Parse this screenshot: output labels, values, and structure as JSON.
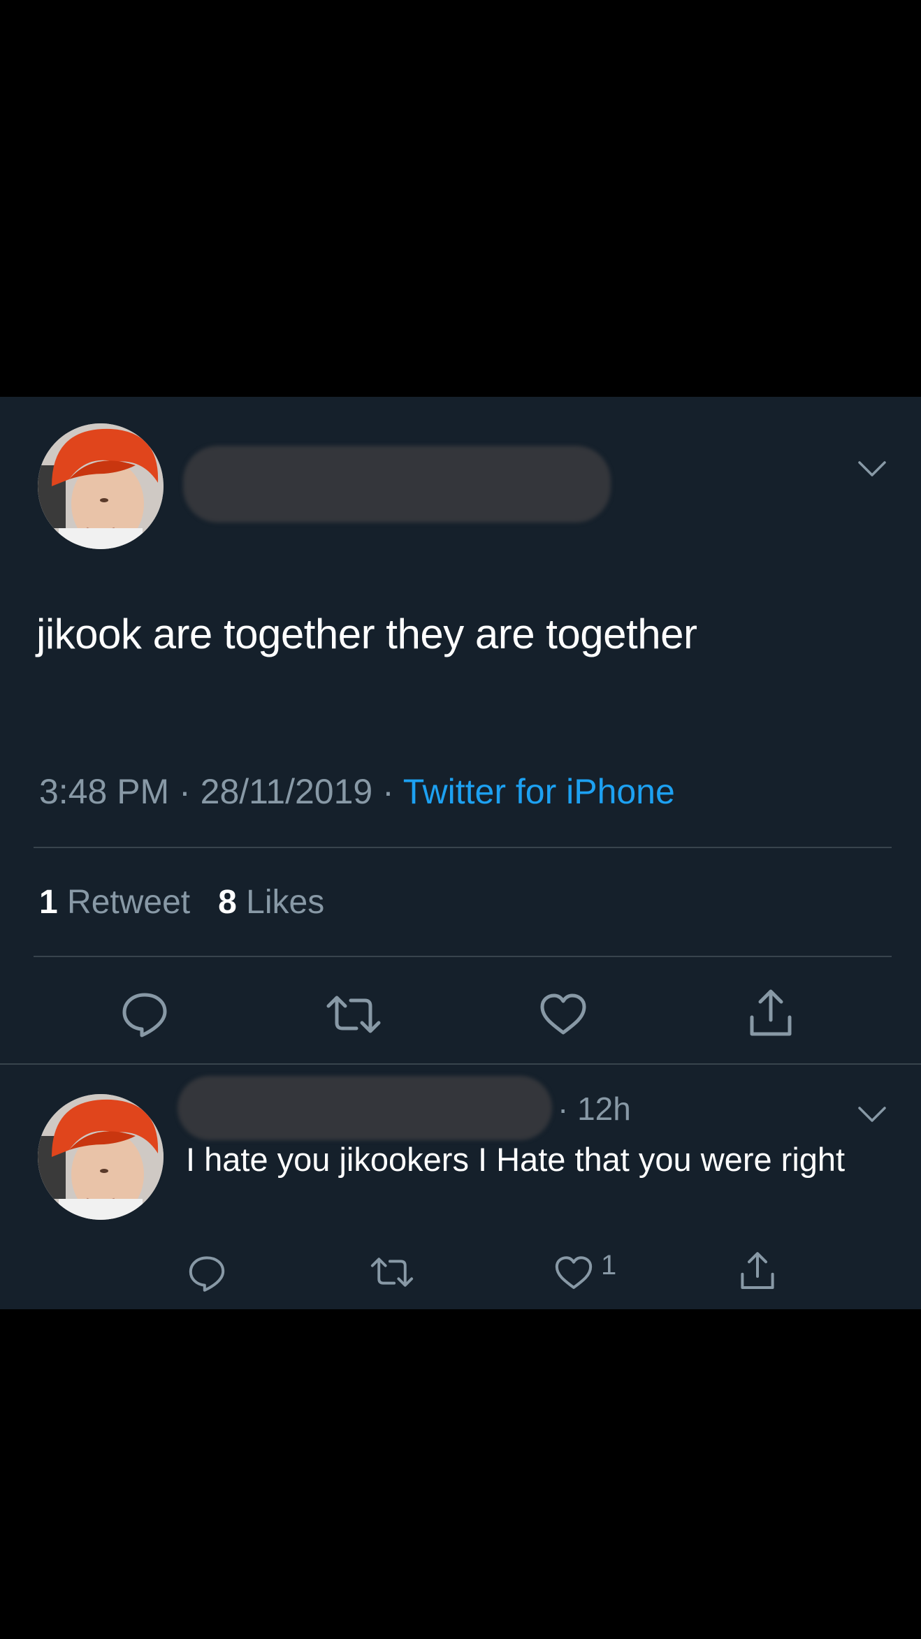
{
  "tweet": {
    "text": "jikook are together  they are together",
    "time": "3:48 PM",
    "separator": " · ",
    "date": "28/11/2019",
    "source": "Twitter for iPhone",
    "retweet_count": "1",
    "retweet_label": " Retweet",
    "like_count": "8",
    "like_label": " Likes",
    "icons": [
      "reply-icon",
      "retweet-icon",
      "like-icon",
      "share-icon"
    ]
  },
  "reply": {
    "time": "· 12h",
    "text": "I hate you jikookers  I Hate that you were right",
    "like_count": "1",
    "icons": [
      "reply-icon",
      "retweet-icon",
      "like-icon",
      "share-icon"
    ]
  },
  "colors": {
    "background": "#15202b",
    "outer": "#000000",
    "text_primary": "#ffffff",
    "text_secondary": "#8899a6",
    "link": "#1da1f2",
    "divider": "#38444d"
  }
}
